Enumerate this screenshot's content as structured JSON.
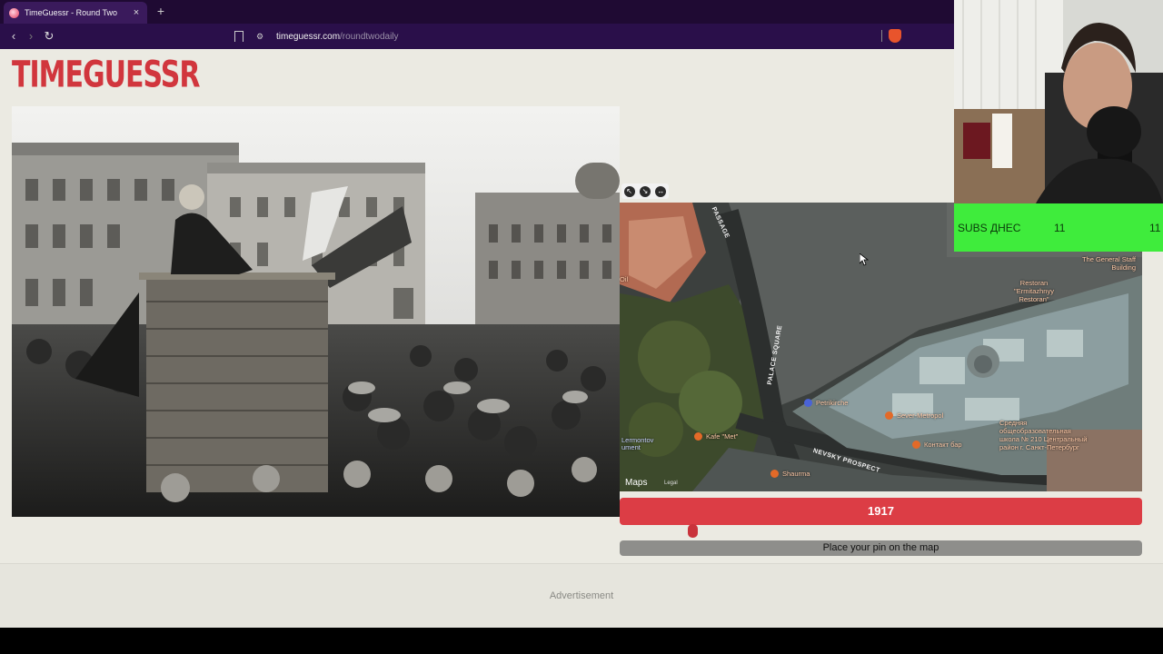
{
  "browser": {
    "tab_title": "TimeGuessr - Round Two",
    "tab_close": "×",
    "new_tab": "+",
    "url_host": "timeguessr.com",
    "url_path": "/roundtwodaily"
  },
  "site": {
    "logo": "TIMEGUESSR"
  },
  "map": {
    "controls": [
      "↖",
      "↘",
      "↔"
    ],
    "brand": "Maps",
    "legal": "Legal",
    "labels": {
      "passage": "PASSAGE",
      "palace_square": "PALACE SQUARE",
      "nevsky": "NEVSKY PROSPECT",
      "staff_building": "The General Staff Building",
      "restoran": "Restoran \"Ermitazhnyy Restoran\"",
      "petrikirche": "Petrikirche",
      "sever": "Sever-Metropol",
      "kontakt": "Контакт бар",
      "school": "Средняя общеобразовательная школа № 210 Центральный район г. Санкт-Петербург",
      "kafe": "Kafe \"Met\"",
      "shaurma": "Shaurma",
      "lermontov": "Lermontov ument",
      "oil": "Oil"
    }
  },
  "guess": {
    "year": "1917",
    "slider_fraction": 0.14,
    "pin_prompt": "Place your pin on the map"
  },
  "ad": {
    "label": "Advertisement"
  },
  "overlay": {
    "subs_label": "SUBS ДНЕС",
    "subs_value_1": "11",
    "subs_value_2": "11"
  },
  "colors": {
    "accent_red": "#dc3d45",
    "logo_red": "#d1363d",
    "page_bg": "#ebeae2",
    "subs_green": "#3fec3c"
  }
}
